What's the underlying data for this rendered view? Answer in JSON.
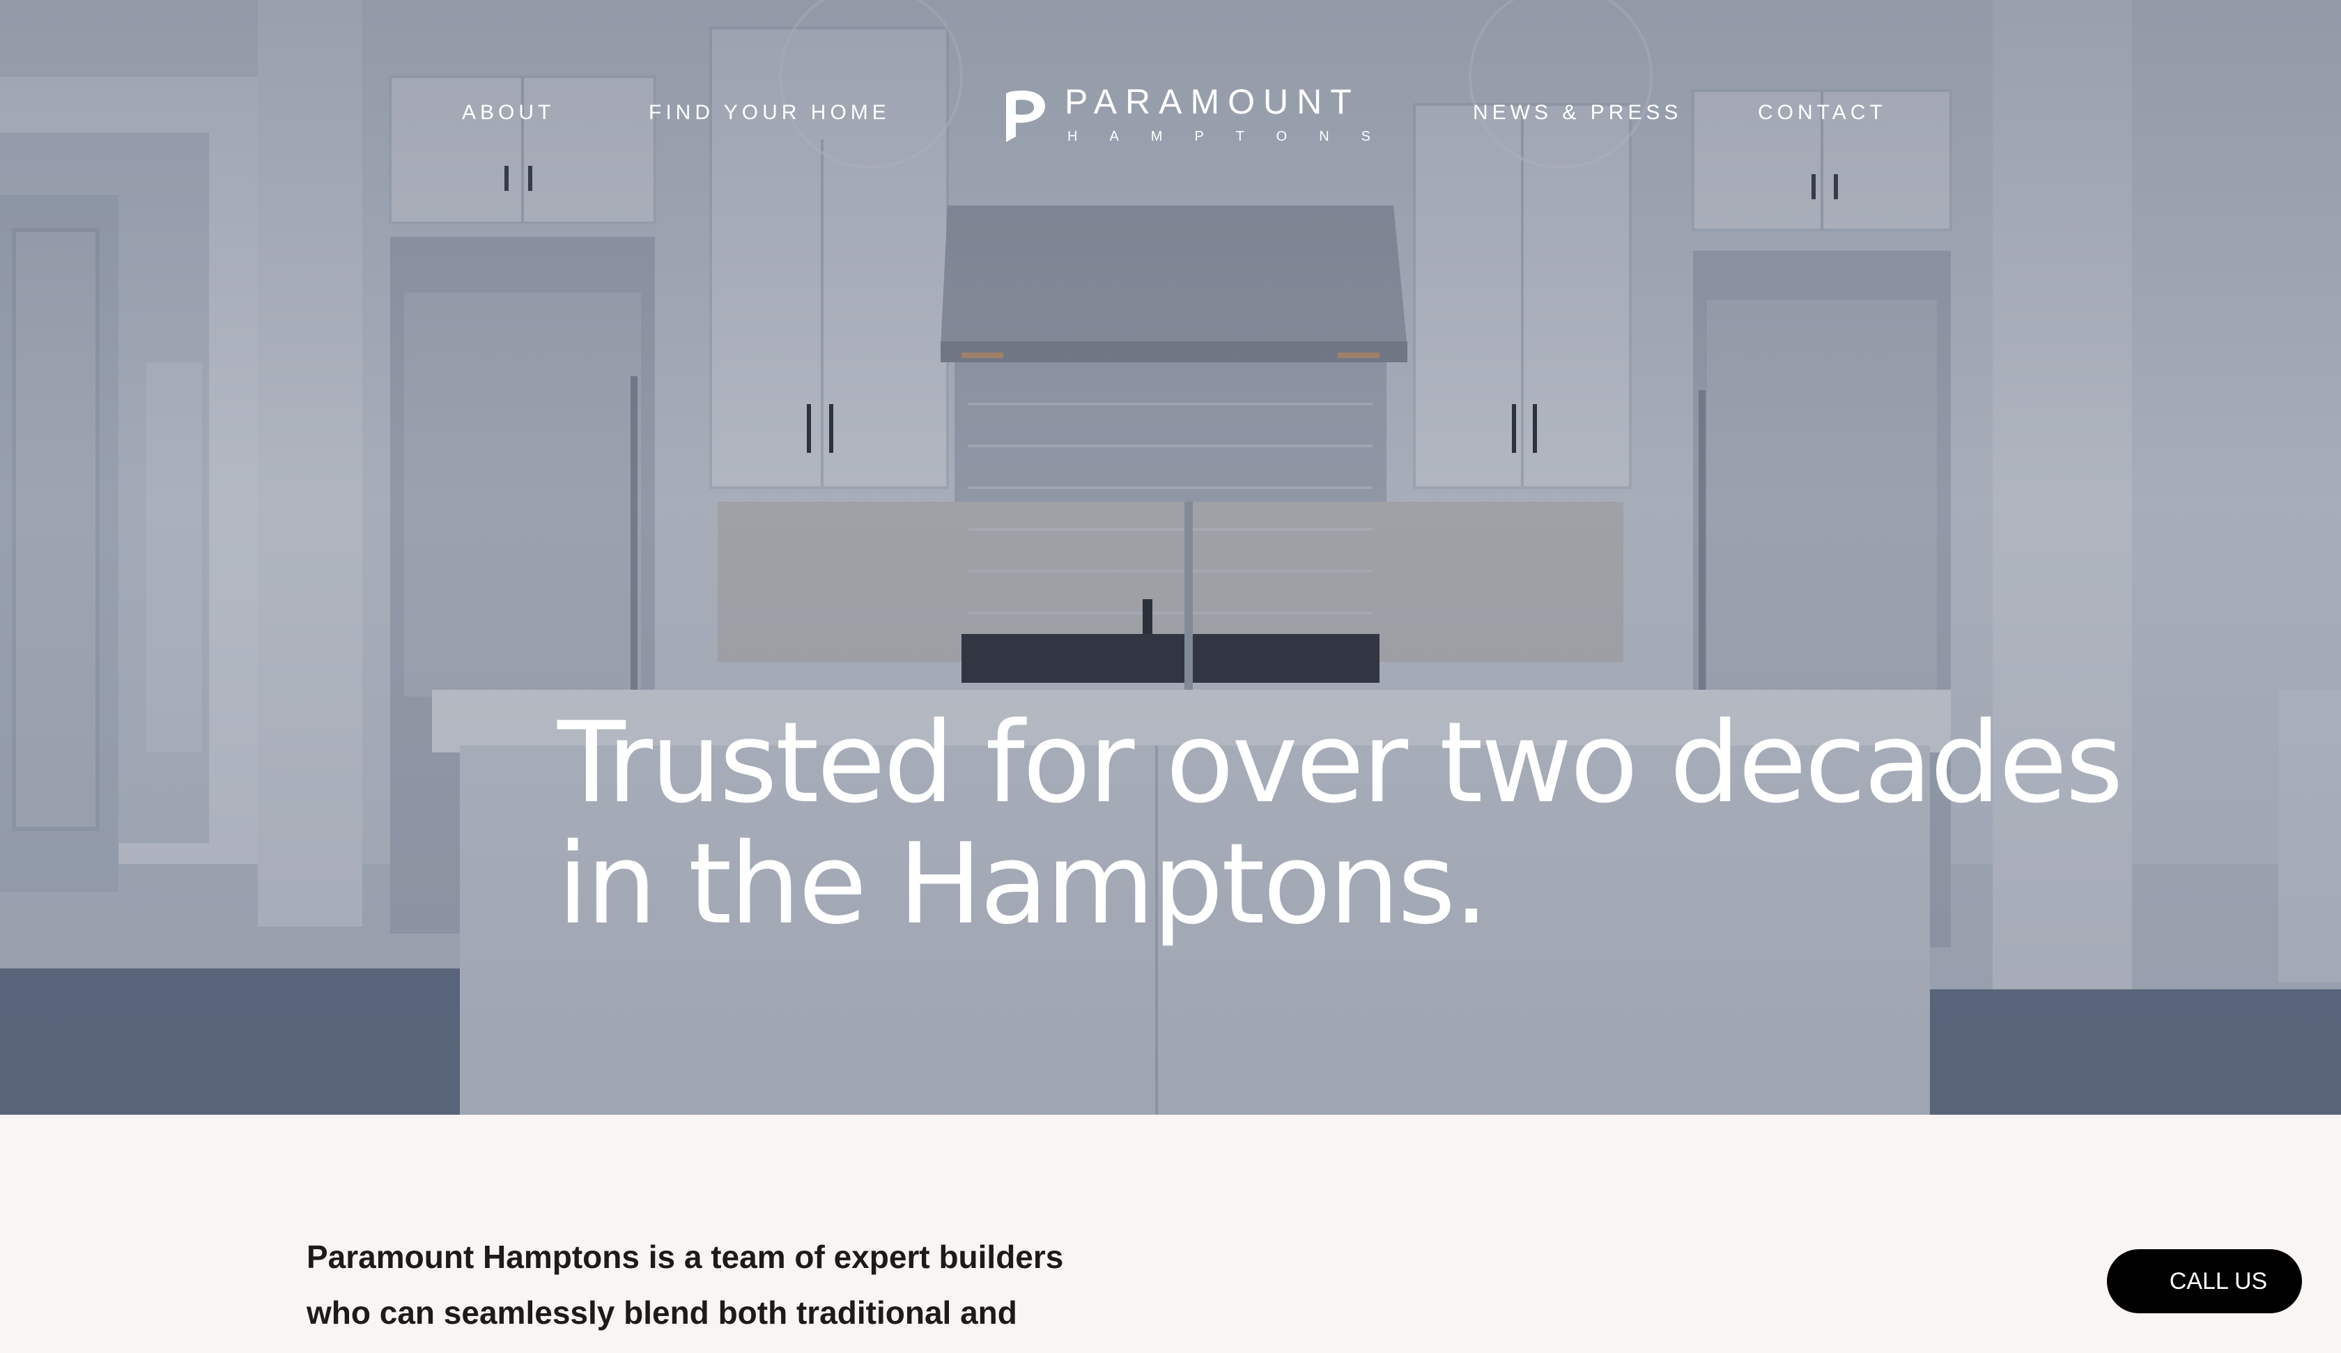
{
  "nav": {
    "left_links": [
      "ABOUT",
      "FIND YOUR HOME"
    ],
    "right_links": [
      "NEWS & PRESS",
      "CONTACT"
    ]
  },
  "logo": {
    "name": "PARAMOUNT",
    "sub": "HAMPTONS"
  },
  "hero": {
    "headline_line1": "Trusted for over two decades",
    "headline_line2": "in the Hamptons.",
    "background": "kitchen-photo"
  },
  "intro": {
    "line1": "Paramount Hamptons is a team of expert builders",
    "line2": "who can seamlessly blend both traditional and"
  },
  "call_button": {
    "label": "CALL US"
  },
  "colors": {
    "page_bg": "#f8f5f2",
    "hero_overlay": "#28344e",
    "text_white": "#ffffff",
    "button_bg": "#000000"
  }
}
